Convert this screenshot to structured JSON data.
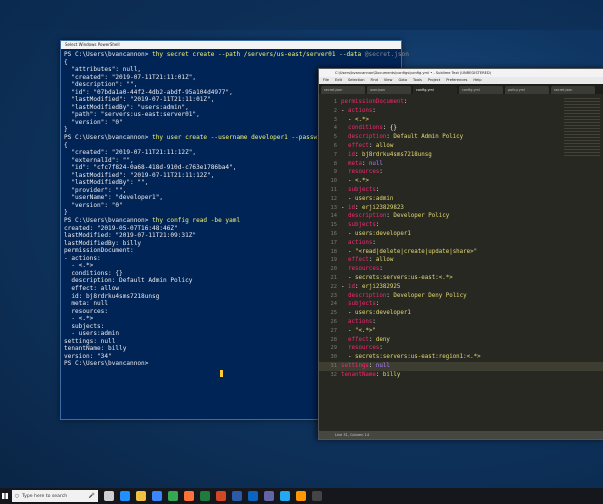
{
  "powershell": {
    "title": "Select Windows PowerShell",
    "lines": [
      {
        "text": "PS C:\\Users\\bvancannon> ",
        "cmd": "thy secret create --path /servers/us-east/server01 --data ",
        "arg": "@secret.json"
      },
      {
        "text": "{"
      },
      {
        "text": "  \"attributes\": null,"
      },
      {
        "text": "  \"created\": \"2019-07-11T21:11:01Z\","
      },
      {
        "text": "  \"description\": \"\","
      },
      {
        "text": "  \"id\": \"07bda1a0-44f2-4db2-abdf-95a104d4977\","
      },
      {
        "text": "  \"lastModified\": \"2019-07-11T21:11:01Z\","
      },
      {
        "text": "  \"lastModifiedBy\": \"users:admin\","
      },
      {
        "text": "  \"path\": \"servers:us-east:server01\","
      },
      {
        "text": "  \"version\": \"0\""
      },
      {
        "text": "}"
      },
      {
        "text": "PS C:\\Users\\bvancannon> ",
        "cmd": "thy user create --username developer1 --passw"
      },
      {
        "text": "{"
      },
      {
        "text": "  \"created\": \"2019-07-11T21:11:12Z\","
      },
      {
        "text": "  \"externalId\": \"\","
      },
      {
        "text": "  \"id\": \"cfc7f824-0a68-418d-910d-c763e1786ba4\","
      },
      {
        "text": "  \"lastModified\": \"2019-07-11T21:11:12Z\","
      },
      {
        "text": "  \"lastModifiedBy\": \"\","
      },
      {
        "text": "  \"provider\": \"\","
      },
      {
        "text": "  \"userName\": \"developer1\","
      },
      {
        "text": "  \"version\": \"0\""
      },
      {
        "text": "}"
      },
      {
        "text": "PS C:\\Users\\bvancannon> ",
        "cmd": "thy config read -be yaml"
      },
      {
        "text": "created: \"2019-05-07T16:48:46Z\""
      },
      {
        "text": "lastModified: \"2019-07-11T21:09:31Z\""
      },
      {
        "text": "lastModifiedBy: billy"
      },
      {
        "text": "permissionDocument:"
      },
      {
        "text": "- actions:"
      },
      {
        "text": "  - <.*>"
      },
      {
        "text": "  conditions: {}"
      },
      {
        "text": "  description: Default Admin Policy"
      },
      {
        "text": "  effect: allow"
      },
      {
        "text": "  id: bj8rdrku4sms7218unsg"
      },
      {
        "text": "  meta: null"
      },
      {
        "text": "  resources:"
      },
      {
        "text": "  - <.*>"
      },
      {
        "text": "  subjects:"
      },
      {
        "text": "  - users:admin"
      },
      {
        "text": "settings: null"
      },
      {
        "text": "tenantName: billy"
      },
      {
        "text": "version: \"34\""
      },
      {
        "text": "PS C:\\Users\\bvancannon>"
      }
    ]
  },
  "sublime": {
    "title": "C:\\Users\\bvancannon\\Documents\\configs\\config.yml • - Sublime Text (UNREGISTERED)",
    "menu": [
      "File",
      "Edit",
      "Selection",
      "Find",
      "View",
      "Goto",
      "Tools",
      "Project",
      "Preferences",
      "Help"
    ],
    "tabs": [
      "secret.json",
      "user.json",
      "config.yml",
      "config.yml",
      "policy.yml",
      "secret.json"
    ],
    "active_tab": 3,
    "status": "Line 31, Column 14",
    "current_line": 31,
    "lines": [
      [
        {
          "c": "k",
          "t": "permissionDocument"
        },
        {
          "c": "p",
          "t": ":"
        }
      ],
      [
        {
          "c": "p",
          "t": "- "
        },
        {
          "c": "k",
          "t": "actions"
        },
        {
          "c": "p",
          "t": ":"
        }
      ],
      [
        {
          "c": "p",
          "t": "  - "
        },
        {
          "c": "v",
          "t": "<.*>"
        }
      ],
      [
        {
          "c": "p",
          "t": "  "
        },
        {
          "c": "k",
          "t": "conditions"
        },
        {
          "c": "p",
          "t": ": {}"
        }
      ],
      [
        {
          "c": "p",
          "t": "  "
        },
        {
          "c": "k",
          "t": "description"
        },
        {
          "c": "p",
          "t": ": "
        },
        {
          "c": "v",
          "t": "Default Admin Policy"
        }
      ],
      [
        {
          "c": "p",
          "t": "  "
        },
        {
          "c": "k",
          "t": "effect"
        },
        {
          "c": "p",
          "t": ": "
        },
        {
          "c": "v",
          "t": "allow"
        }
      ],
      [
        {
          "c": "p",
          "t": "  "
        },
        {
          "c": "k",
          "t": "id"
        },
        {
          "c": "p",
          "t": ": "
        },
        {
          "c": "v",
          "t": "bj8rdrku4sms7218unsg"
        }
      ],
      [
        {
          "c": "p",
          "t": "  "
        },
        {
          "c": "k",
          "t": "meta"
        },
        {
          "c": "p",
          "t": ": "
        },
        {
          "c": "n",
          "t": "null"
        }
      ],
      [
        {
          "c": "p",
          "t": "  "
        },
        {
          "c": "k",
          "t": "resources"
        },
        {
          "c": "p",
          "t": ":"
        }
      ],
      [
        {
          "c": "p",
          "t": "  - "
        },
        {
          "c": "v",
          "t": "<.*>"
        }
      ],
      [
        {
          "c": "p",
          "t": "  "
        },
        {
          "c": "k",
          "t": "subjects"
        },
        {
          "c": "p",
          "t": ":"
        }
      ],
      [
        {
          "c": "p",
          "t": "  - "
        },
        {
          "c": "v",
          "t": "users:admin"
        }
      ],
      [
        {
          "c": "p",
          "t": "- "
        },
        {
          "c": "k",
          "t": "id"
        },
        {
          "c": "p",
          "t": ": "
        },
        {
          "c": "v",
          "t": "erji23829823"
        }
      ],
      [
        {
          "c": "p",
          "t": "  "
        },
        {
          "c": "k",
          "t": "description"
        },
        {
          "c": "p",
          "t": ": "
        },
        {
          "c": "v",
          "t": "Developer Policy"
        }
      ],
      [
        {
          "c": "p",
          "t": "  "
        },
        {
          "c": "k",
          "t": "subjects"
        },
        {
          "c": "p",
          "t": ":"
        }
      ],
      [
        {
          "c": "p",
          "t": "  - "
        },
        {
          "c": "v",
          "t": "users:developer1"
        }
      ],
      [
        {
          "c": "p",
          "t": "  "
        },
        {
          "c": "k",
          "t": "actions"
        },
        {
          "c": "p",
          "t": ":"
        }
      ],
      [
        {
          "c": "p",
          "t": "  - "
        },
        {
          "c": "v",
          "t": "\"<read|delete|create|update|share>\""
        }
      ],
      [
        {
          "c": "p",
          "t": "  "
        },
        {
          "c": "k",
          "t": "effect"
        },
        {
          "c": "p",
          "t": ": "
        },
        {
          "c": "v",
          "t": "allow"
        }
      ],
      [
        {
          "c": "p",
          "t": "  "
        },
        {
          "c": "k",
          "t": "resources"
        },
        {
          "c": "p",
          "t": ":"
        }
      ],
      [
        {
          "c": "p",
          "t": "  - "
        },
        {
          "c": "v",
          "t": "secrets:servers:us-east:<.*>"
        }
      ],
      [
        {
          "c": "p",
          "t": "- "
        },
        {
          "c": "k",
          "t": "id"
        },
        {
          "c": "p",
          "t": ": "
        },
        {
          "c": "v",
          "t": "erji2382925"
        }
      ],
      [
        {
          "c": "p",
          "t": "  "
        },
        {
          "c": "k",
          "t": "description"
        },
        {
          "c": "p",
          "t": ": "
        },
        {
          "c": "v",
          "t": "Developer Deny Policy"
        }
      ],
      [
        {
          "c": "p",
          "t": "  "
        },
        {
          "c": "k",
          "t": "subjects"
        },
        {
          "c": "p",
          "t": ":"
        }
      ],
      [
        {
          "c": "p",
          "t": "  - "
        },
        {
          "c": "v",
          "t": "users:developer1"
        }
      ],
      [
        {
          "c": "p",
          "t": "  "
        },
        {
          "c": "k",
          "t": "actions"
        },
        {
          "c": "p",
          "t": ":"
        }
      ],
      [
        {
          "c": "p",
          "t": "  - "
        },
        {
          "c": "v",
          "t": "\"<.*>\""
        }
      ],
      [
        {
          "c": "p",
          "t": "  "
        },
        {
          "c": "k",
          "t": "effect"
        },
        {
          "c": "p",
          "t": ": "
        },
        {
          "c": "v",
          "t": "deny"
        }
      ],
      [
        {
          "c": "p",
          "t": "  "
        },
        {
          "c": "k",
          "t": "resources"
        },
        {
          "c": "p",
          "t": ":"
        }
      ],
      [
        {
          "c": "p",
          "t": "  - "
        },
        {
          "c": "v",
          "t": "secrets:servers:us-east:region1:<.*>"
        }
      ],
      [
        {
          "c": "k",
          "t": "settings"
        },
        {
          "c": "p",
          "t": ": "
        },
        {
          "c": "n",
          "t": "null"
        }
      ],
      [
        {
          "c": "k",
          "t": "tenantName"
        },
        {
          "c": "p",
          "t": ": "
        },
        {
          "c": "v",
          "t": "billy"
        }
      ]
    ]
  },
  "taskbar": {
    "search_placeholder": "Type here to search",
    "search_icon": "search-icon",
    "mic_icon": "microphone-icon",
    "icons": [
      {
        "name": "task-view-icon",
        "color": "#cfcfcf"
      },
      {
        "name": "edge-icon",
        "color": "#1e90ff"
      },
      {
        "name": "file-explorer-icon",
        "color": "#f0c040"
      },
      {
        "name": "store-icon",
        "color": "#3a86ff"
      },
      {
        "name": "chrome-icon",
        "color": "#34a853"
      },
      {
        "name": "firefox-icon",
        "color": "#ff7139"
      },
      {
        "name": "excel-icon",
        "color": "#1f7a3d"
      },
      {
        "name": "powerpoint-icon",
        "color": "#d24726"
      },
      {
        "name": "powershell-icon",
        "color": "#2b5aa8"
      },
      {
        "name": "outlook-icon",
        "color": "#0a64c2"
      },
      {
        "name": "teams-icon",
        "color": "#6264a7"
      },
      {
        "name": "vscode-icon",
        "color": "#23a9f2"
      },
      {
        "name": "sublime-icon",
        "color": "#ff9800"
      },
      {
        "name": "terminal-icon",
        "color": "#444444"
      }
    ]
  }
}
